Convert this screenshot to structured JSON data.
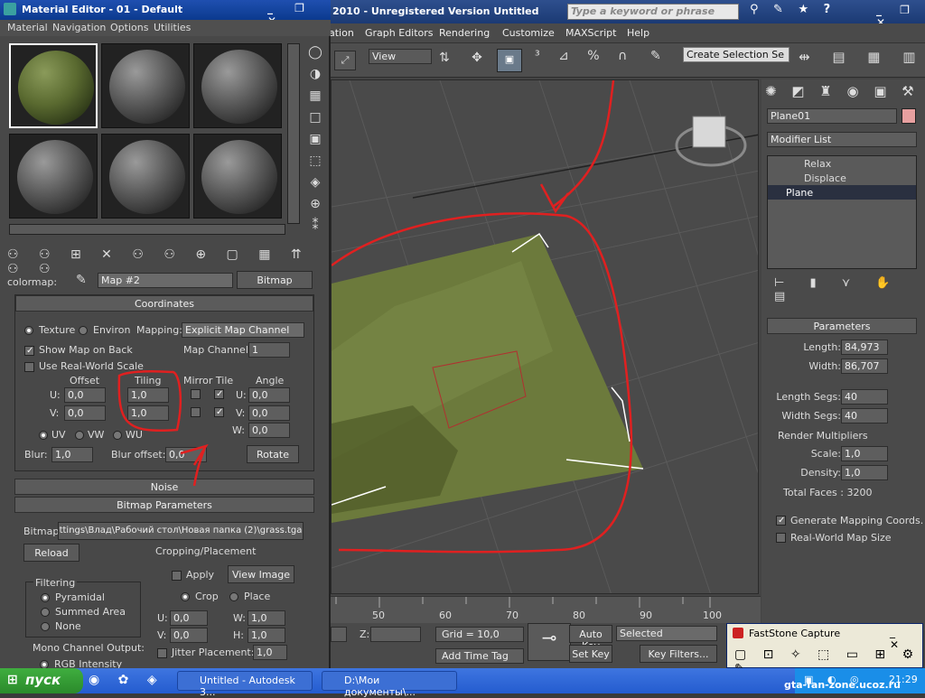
{
  "material_editor": {
    "title": "Material Editor - 01 - Default",
    "menu": [
      "Material",
      "Navigation",
      "Options",
      "Utilities"
    ],
    "map_label": "colormap:",
    "map_name": "Map #2",
    "map_type": "Bitmap",
    "coordinates": {
      "header": "Coordinates",
      "texture": "Texture",
      "environ": "Environ",
      "mapping_label": "Mapping:",
      "mapping_value": "Explicit Map Channel",
      "show_map_on_back": "Show Map on Back",
      "map_channel_label": "Map Channel:",
      "map_channel_value": "1",
      "use_real_world": "Use Real-World Scale",
      "offset": "Offset",
      "tiling": "Tiling",
      "mirror_tile": "Mirror Tile",
      "angle": "Angle",
      "u_label": "U:",
      "v_label": "V:",
      "w_label": "W:",
      "u_offset": "0,0",
      "v_offset": "0,0",
      "u_tiling": "1,0",
      "v_tiling": "1,0",
      "u_angle": "0,0",
      "v_angle": "0,0",
      "w_angle": "0,0",
      "uv": "UV",
      "vw": "VW",
      "wu": "WU",
      "blur_label": "Blur:",
      "blur_value": "1,0",
      "blur_offset_label": "Blur offset:",
      "blur_offset_value": "0,0",
      "rotate": "Rotate"
    },
    "noise_header": "Noise",
    "bitmap_params": {
      "header": "Bitmap Parameters",
      "bitmap_label": "Bitmap:",
      "bitmap_path": "ttings\\Влад\\Рабочий стол\\Новая папка (2)\\grass.tga",
      "reload": "Reload",
      "cropping": "Cropping/Placement",
      "apply": "Apply",
      "view_image": "View Image",
      "crop": "Crop",
      "place": "Place",
      "filtering": "Filtering",
      "pyramidal": "Pyramidal",
      "summed_area": "Summed Area",
      "none": "None",
      "u_val": "0,0",
      "v_val": "0,0",
      "w_val": "1,0",
      "h_val": "1,0",
      "mono": "Mono Channel Output:",
      "rgb": "RGB Intensity",
      "jitter": "Jitter Placement:",
      "jitter_val": "1,0"
    }
  },
  "max": {
    "title": "2010  -  Unregistered Version    Untitled",
    "search_placeholder": "Type a keyword or phrase",
    "menu": [
      "ation",
      "Graph Editors",
      "Rendering",
      "Customize",
      "MAXScript",
      "Help"
    ],
    "view_dropdown": "View",
    "selection_set": "Create Selection Se",
    "ruler": [
      "50",
      "60",
      "70",
      "80",
      "90",
      "100"
    ],
    "z_label": "Z:",
    "grid": "Grid = 10,0",
    "auto_key": "Auto Key",
    "selected": "Selected",
    "set_key": "Set Key",
    "key_filters": "Key Filters...",
    "add_time_tag": "Add Time Tag"
  },
  "command_panel": {
    "object_name": "Plane01",
    "object_color": "#e8a0a0",
    "modifier_list": "Modifier List",
    "stack": [
      "Relax",
      "Displace",
      "Plane"
    ],
    "params_header": "Parameters",
    "length_label": "Length:",
    "length_value": "84,973",
    "width_label": "Width:",
    "width_value": "86,707",
    "length_segs_label": "Length Segs:",
    "length_segs_value": "40",
    "width_segs_label": "Width Segs:",
    "width_segs_value": "40",
    "render_mult": "Render Multipliers",
    "scale_label": "Scale:",
    "scale_value": "1,0",
    "density_label": "Density:",
    "density_value": "1,0",
    "total_faces": "Total Faces : 3200",
    "gen_mapping": "Generate Mapping Coords.",
    "real_world": "Real-World Map Size"
  },
  "taskbar": {
    "start": "пуск",
    "task1": "Untitled - Autodesk 3...",
    "task2": "D:\\Мои документы\\...",
    "clock": "21:29",
    "faststone": "FastStone Capture",
    "watermark": "gta-fan-zone.ucoz.ru"
  }
}
